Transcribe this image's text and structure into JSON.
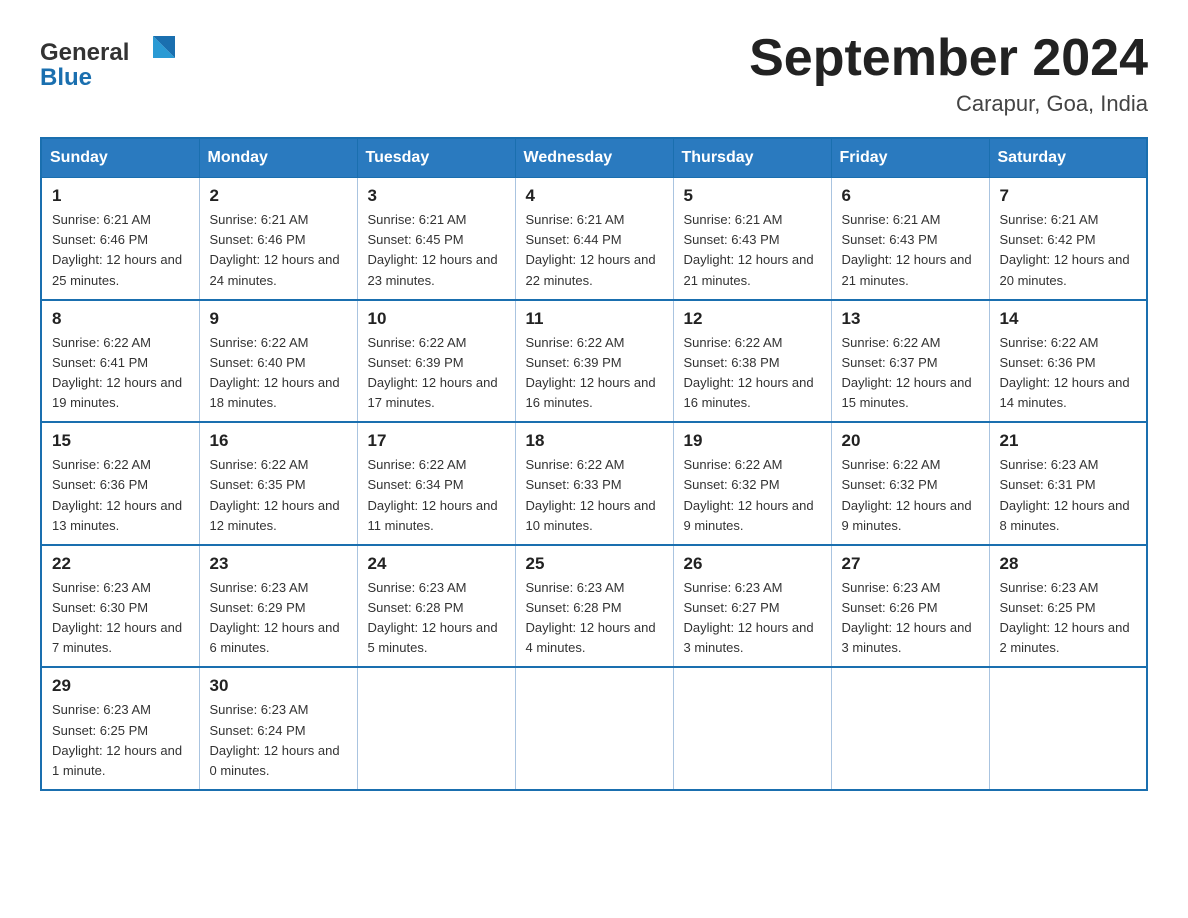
{
  "header": {
    "logo_text_black": "General",
    "logo_text_blue": "Blue",
    "month_title": "September 2024",
    "location": "Carapur, Goa, India"
  },
  "days_of_week": [
    "Sunday",
    "Monday",
    "Tuesday",
    "Wednesday",
    "Thursday",
    "Friday",
    "Saturday"
  ],
  "weeks": [
    [
      {
        "day": "1",
        "sunrise": "Sunrise: 6:21 AM",
        "sunset": "Sunset: 6:46 PM",
        "daylight": "Daylight: 12 hours and 25 minutes."
      },
      {
        "day": "2",
        "sunrise": "Sunrise: 6:21 AM",
        "sunset": "Sunset: 6:46 PM",
        "daylight": "Daylight: 12 hours and 24 minutes."
      },
      {
        "day": "3",
        "sunrise": "Sunrise: 6:21 AM",
        "sunset": "Sunset: 6:45 PM",
        "daylight": "Daylight: 12 hours and 23 minutes."
      },
      {
        "day": "4",
        "sunrise": "Sunrise: 6:21 AM",
        "sunset": "Sunset: 6:44 PM",
        "daylight": "Daylight: 12 hours and 22 minutes."
      },
      {
        "day": "5",
        "sunrise": "Sunrise: 6:21 AM",
        "sunset": "Sunset: 6:43 PM",
        "daylight": "Daylight: 12 hours and 21 minutes."
      },
      {
        "day": "6",
        "sunrise": "Sunrise: 6:21 AM",
        "sunset": "Sunset: 6:43 PM",
        "daylight": "Daylight: 12 hours and 21 minutes."
      },
      {
        "day": "7",
        "sunrise": "Sunrise: 6:21 AM",
        "sunset": "Sunset: 6:42 PM",
        "daylight": "Daylight: 12 hours and 20 minutes."
      }
    ],
    [
      {
        "day": "8",
        "sunrise": "Sunrise: 6:22 AM",
        "sunset": "Sunset: 6:41 PM",
        "daylight": "Daylight: 12 hours and 19 minutes."
      },
      {
        "day": "9",
        "sunrise": "Sunrise: 6:22 AM",
        "sunset": "Sunset: 6:40 PM",
        "daylight": "Daylight: 12 hours and 18 minutes."
      },
      {
        "day": "10",
        "sunrise": "Sunrise: 6:22 AM",
        "sunset": "Sunset: 6:39 PM",
        "daylight": "Daylight: 12 hours and 17 minutes."
      },
      {
        "day": "11",
        "sunrise": "Sunrise: 6:22 AM",
        "sunset": "Sunset: 6:39 PM",
        "daylight": "Daylight: 12 hours and 16 minutes."
      },
      {
        "day": "12",
        "sunrise": "Sunrise: 6:22 AM",
        "sunset": "Sunset: 6:38 PM",
        "daylight": "Daylight: 12 hours and 16 minutes."
      },
      {
        "day": "13",
        "sunrise": "Sunrise: 6:22 AM",
        "sunset": "Sunset: 6:37 PM",
        "daylight": "Daylight: 12 hours and 15 minutes."
      },
      {
        "day": "14",
        "sunrise": "Sunrise: 6:22 AM",
        "sunset": "Sunset: 6:36 PM",
        "daylight": "Daylight: 12 hours and 14 minutes."
      }
    ],
    [
      {
        "day": "15",
        "sunrise": "Sunrise: 6:22 AM",
        "sunset": "Sunset: 6:36 PM",
        "daylight": "Daylight: 12 hours and 13 minutes."
      },
      {
        "day": "16",
        "sunrise": "Sunrise: 6:22 AM",
        "sunset": "Sunset: 6:35 PM",
        "daylight": "Daylight: 12 hours and 12 minutes."
      },
      {
        "day": "17",
        "sunrise": "Sunrise: 6:22 AM",
        "sunset": "Sunset: 6:34 PM",
        "daylight": "Daylight: 12 hours and 11 minutes."
      },
      {
        "day": "18",
        "sunrise": "Sunrise: 6:22 AM",
        "sunset": "Sunset: 6:33 PM",
        "daylight": "Daylight: 12 hours and 10 minutes."
      },
      {
        "day": "19",
        "sunrise": "Sunrise: 6:22 AM",
        "sunset": "Sunset: 6:32 PM",
        "daylight": "Daylight: 12 hours and 9 minutes."
      },
      {
        "day": "20",
        "sunrise": "Sunrise: 6:22 AM",
        "sunset": "Sunset: 6:32 PM",
        "daylight": "Daylight: 12 hours and 9 minutes."
      },
      {
        "day": "21",
        "sunrise": "Sunrise: 6:23 AM",
        "sunset": "Sunset: 6:31 PM",
        "daylight": "Daylight: 12 hours and 8 minutes."
      }
    ],
    [
      {
        "day": "22",
        "sunrise": "Sunrise: 6:23 AM",
        "sunset": "Sunset: 6:30 PM",
        "daylight": "Daylight: 12 hours and 7 minutes."
      },
      {
        "day": "23",
        "sunrise": "Sunrise: 6:23 AM",
        "sunset": "Sunset: 6:29 PM",
        "daylight": "Daylight: 12 hours and 6 minutes."
      },
      {
        "day": "24",
        "sunrise": "Sunrise: 6:23 AM",
        "sunset": "Sunset: 6:28 PM",
        "daylight": "Daylight: 12 hours and 5 minutes."
      },
      {
        "day": "25",
        "sunrise": "Sunrise: 6:23 AM",
        "sunset": "Sunset: 6:28 PM",
        "daylight": "Daylight: 12 hours and 4 minutes."
      },
      {
        "day": "26",
        "sunrise": "Sunrise: 6:23 AM",
        "sunset": "Sunset: 6:27 PM",
        "daylight": "Daylight: 12 hours and 3 minutes."
      },
      {
        "day": "27",
        "sunrise": "Sunrise: 6:23 AM",
        "sunset": "Sunset: 6:26 PM",
        "daylight": "Daylight: 12 hours and 3 minutes."
      },
      {
        "day": "28",
        "sunrise": "Sunrise: 6:23 AM",
        "sunset": "Sunset: 6:25 PM",
        "daylight": "Daylight: 12 hours and 2 minutes."
      }
    ],
    [
      {
        "day": "29",
        "sunrise": "Sunrise: 6:23 AM",
        "sunset": "Sunset: 6:25 PM",
        "daylight": "Daylight: 12 hours and 1 minute."
      },
      {
        "day": "30",
        "sunrise": "Sunrise: 6:23 AM",
        "sunset": "Sunset: 6:24 PM",
        "daylight": "Daylight: 12 hours and 0 minutes."
      },
      null,
      null,
      null,
      null,
      null
    ]
  ]
}
